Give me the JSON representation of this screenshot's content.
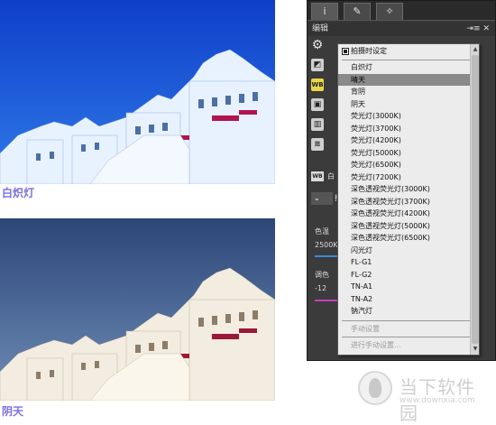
{
  "captions": {
    "top": "白炽灯",
    "bottom": "阴天"
  },
  "editor": {
    "tabs": [
      {
        "icon": "info-icon",
        "glyph": "i"
      },
      {
        "icon": "edit-icon",
        "glyph": "✎"
      },
      {
        "icon": "magic-wand-icon",
        "glyph": "✧"
      }
    ],
    "header_title": "编辑",
    "header_controls": "⇥≡ ✕",
    "side_fragments": {
      "wb_row_text": "白",
      "wb_select_text": "拍",
      "temp_label": "色温",
      "temp_value": "2500K",
      "tint_label": "调色",
      "tint_value": "-12"
    }
  },
  "wb_menu": {
    "header_item": "拍摄时设定",
    "items": [
      "白炽灯",
      "晴天",
      "背阴",
      "阴天",
      "荧光灯(3000K)",
      "荧光灯(3700K)",
      "荧光灯(4200K)",
      "荧光灯(5000K)",
      "荧光灯(6500K)",
      "荧光灯(7200K)",
      "深色透视荧光灯(3000K)",
      "深色透视荧光灯(3700K)",
      "深色透视荧光灯(4200K)",
      "深色透视荧光灯(5000K)",
      "深色透视荧光灯(6500K)",
      "闪光灯",
      "FL-G1",
      "FL-G2",
      "TN-A1",
      "TN-A2",
      "钠汽灯"
    ],
    "selected_index": 1,
    "disabled_items": [
      "手动设置",
      "进行手动设置..."
    ]
  },
  "watermark": {
    "name": "当下软件园",
    "url": "www.downxia.com"
  },
  "colors": {
    "caption": "#7a6ee0",
    "sky_blue": "#1a54d8",
    "sky_gray": "#3c5a8c",
    "panel_bg": "#3b3b3b",
    "menu_bg": "#ececec",
    "menu_selected": "#8a8a8a",
    "temp_slider": "#3b8ad9",
    "tint_slider": "#c63ec6"
  }
}
